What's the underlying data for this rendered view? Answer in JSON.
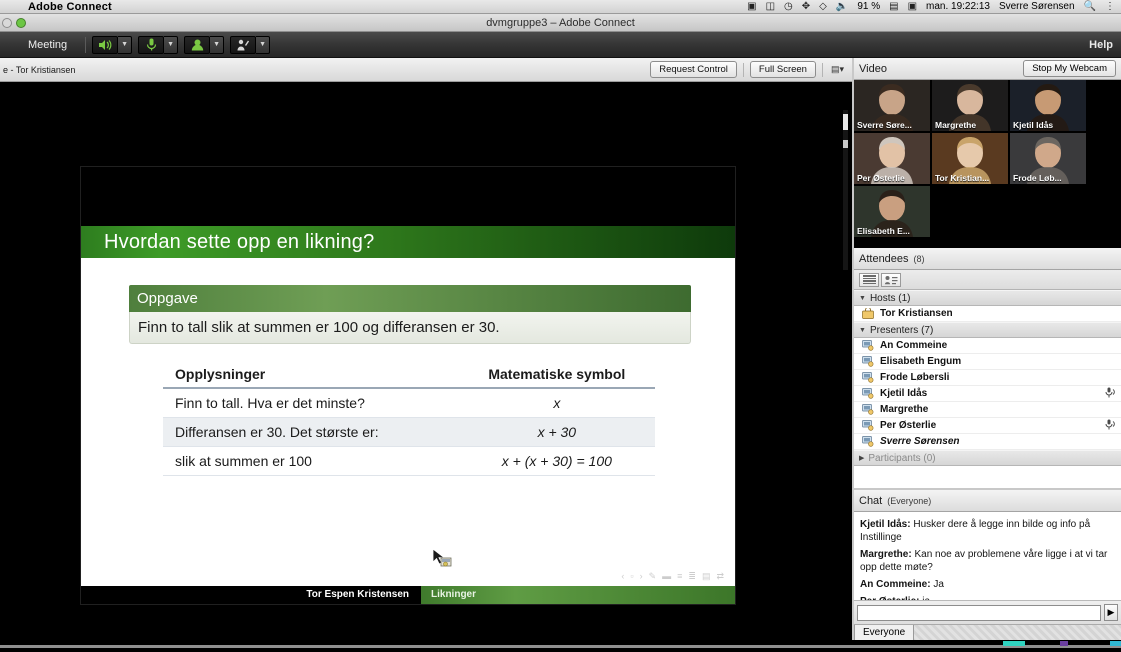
{
  "macos": {
    "app_name": "Adobe Connect",
    "status_icons": [
      "s-badge-icon",
      "binoculars-icon",
      "clock-icon",
      "bluetooth-icon",
      "wifi-icon",
      "volume-icon"
    ],
    "battery_percent": "91 %",
    "battery_icon": "battery-icon",
    "display_icon": "display-icon",
    "clock": "man. 19:22:13",
    "user": "Sverre Sørensen",
    "search_icon": "search-icon",
    "menu_icon": "list-menu-icon"
  },
  "window": {
    "title": "dvmgruppe3 – Adobe Connect"
  },
  "meeting_bar": {
    "menu_label": "Meeting",
    "help_label": "Help",
    "tools": [
      {
        "name": "speaker-icon",
        "glyph": "🔊"
      },
      {
        "name": "microphone-icon",
        "glyph": "🎤"
      },
      {
        "name": "webcam-icon",
        "glyph": "👤"
      },
      {
        "name": "raise-hand-icon",
        "glyph": "✋"
      }
    ]
  },
  "share_pod": {
    "title": "e  - Tor Kristiansen",
    "request_control_label": "Request Control",
    "full_screen_label": "Full Screen",
    "pod_menu_icon": "pod-menu-icon"
  },
  "slide": {
    "title": "Hvordan sette opp en likning?",
    "oppgave_heading": "Oppgave",
    "oppgave_text": "Finn to tall slik at summen er 100 og differansen er 30.",
    "table": {
      "headers": [
        "Opplysninger",
        "Matematiske symbol"
      ],
      "rows": [
        [
          "Finn to tall. Hva er det minste?",
          "x"
        ],
        [
          "Differansen er 30. Det største er:",
          "x + 30"
        ],
        [
          "slik at summen er 100",
          "x + (x + 30) = 100"
        ]
      ]
    },
    "footer_author": "Tor Espen Kristensen",
    "footer_topic": "Likninger",
    "toolbar_icons": [
      "prev-icon",
      "slide-icon",
      "next-icon",
      "pen-icon",
      "marker-icon",
      "list-icon",
      "outline-icon",
      "layout-icon",
      "zoom-icon"
    ]
  },
  "video_pod": {
    "title": "Video",
    "stop_webcam_label": "Stop My Webcam",
    "tiles": [
      {
        "label": "Sverre Søre...",
        "skin": "#c8a488",
        "bg": "#2b2622",
        "hair": "#3b2b20"
      },
      {
        "label": "Margrethe",
        "skin": "#d8b79d",
        "bg": "#1d1c1c",
        "hair": "#4a3a2c"
      },
      {
        "label": "Kjetil Idås",
        "skin": "#c79a74",
        "bg": "#1b2029",
        "hair": "#241a12"
      },
      {
        "label": "Per Østerlie",
        "skin": "#e2c2a6",
        "bg": "#4a3a32",
        "hair": "#cfc6bd"
      },
      {
        "label": "Tor Kristian...",
        "skin": "#e6c9ab",
        "bg": "#5a3a20",
        "hair": "#c9a46a"
      },
      {
        "label": "Frode Løb...",
        "skin": "#d0a88a",
        "bg": "#3a3a3c",
        "hair": "#6c6660"
      },
      {
        "label": "Elisabeth E...",
        "skin": "#c99f80",
        "bg": "#2e352c",
        "hair": "#2a2019"
      }
    ]
  },
  "attendees_pod": {
    "title": "Attendees",
    "count_label": "(8)",
    "view_buttons": [
      "list-view-icon",
      "card-view-icon"
    ],
    "groups": [
      {
        "name": "Hosts",
        "count_label": "(1)",
        "expanded": true,
        "members": [
          {
            "name": "Tor Kristiansen",
            "role": "host",
            "mic": false,
            "me": false
          }
        ]
      },
      {
        "name": "Presenters",
        "count_label": "(7)",
        "expanded": true,
        "members": [
          {
            "name": "An Commeine",
            "role": "presenter",
            "mic": false,
            "me": false
          },
          {
            "name": "Elisabeth Engum",
            "role": "presenter",
            "mic": false,
            "me": false
          },
          {
            "name": "Frode Løbersli",
            "role": "presenter",
            "mic": false,
            "me": false
          },
          {
            "name": "Kjetil Idås",
            "role": "presenter",
            "mic": true,
            "me": false
          },
          {
            "name": "Margrethe",
            "role": "presenter",
            "mic": false,
            "me": false
          },
          {
            "name": "Per Østerlie",
            "role": "presenter",
            "mic": true,
            "me": false
          },
          {
            "name": "Sverre Sørensen",
            "role": "presenter",
            "mic": false,
            "me": true
          }
        ]
      },
      {
        "name": "Participants",
        "count_label": "(0)",
        "expanded": false,
        "members": []
      }
    ]
  },
  "chat_pod": {
    "title": "Chat",
    "scope_label": "(Everyone)",
    "messages": [
      {
        "author": "Kjetil Idås:",
        "text": " Husker dere å legge inn bilde og info på Instillinge"
      },
      {
        "author": "Margrethe:",
        "text": " Kan noe av problemene våre ligge i at vi tar opp dette møte?"
      },
      {
        "author": "An Commeine:",
        "text": " Ja"
      },
      {
        "author": "Per Østerlie:",
        "text": " ja"
      }
    ],
    "input_value": "",
    "send_icon": "send-icon",
    "tab_label": "Everyone"
  }
}
